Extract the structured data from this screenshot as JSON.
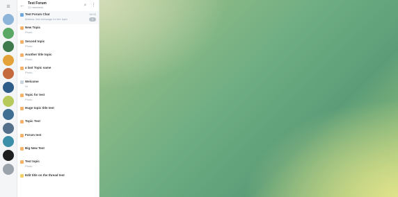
{
  "window": {
    "menu_icon": "menu-icon",
    "back_icon": "back-arrow-icon"
  },
  "forum": {
    "title": "Test Forum",
    "subtitle": "12 members",
    "search_icon": "search-icon",
    "more_icon": "more-icon"
  },
  "topics": [
    {
      "name": "Test Forum Chat",
      "preview": "Mateus: test message for the topic",
      "time": "16:03",
      "count": "1",
      "icon_color": "#6fa8dc",
      "pinned": true
    },
    {
      "name": "New Topic",
      "preview": "Photo",
      "time": "",
      "count": "",
      "icon_color": "#f6b26b"
    },
    {
      "name": "Second topic",
      "preview": "Photo",
      "time": "",
      "count": "",
      "icon_color": "#f6b26b"
    },
    {
      "name": "Another title topic",
      "preview": "Photo",
      "time": "",
      "count": "",
      "icon_color": "#f6b26b"
    },
    {
      "name": "a last Topic name",
      "preview": "Photo",
      "time": "",
      "count": "",
      "icon_color": "#f6b26b"
    },
    {
      "name": "Welcome",
      "preview": "Hi",
      "time": "",
      "count": "",
      "icon_color": "#c9d7e2"
    },
    {
      "name": "Topic for test",
      "preview": "Photo",
      "time": "",
      "count": "",
      "icon_color": "#f6b26b"
    },
    {
      "name": "Huge topic title test",
      "preview": "",
      "time": "",
      "count": "",
      "icon_color": "#f6b26b"
    },
    {
      "name": "Topic Test",
      "preview": "",
      "time": "",
      "count": "",
      "icon_color": "#f6b26b"
    },
    {
      "name": "Forum test",
      "preview": "",
      "time": "",
      "count": "",
      "icon_color": "#f6b26b"
    },
    {
      "name": "Big New Test",
      "preview": "",
      "time": "",
      "count": "",
      "icon_color": "#f6b26b"
    },
    {
      "name": "Test topic",
      "preview": "Photo",
      "time": "",
      "count": "",
      "icon_color": "#f6b26b"
    },
    {
      "name": "Edit title on the thread test",
      "preview": "",
      "time": "",
      "count": "",
      "icon_color": "#f2d16b"
    }
  ],
  "rail": [
    {
      "name": "avatar-forum",
      "color": "#8db4d9"
    },
    {
      "name": "avatar-chat-1",
      "color": "#5aa865"
    },
    {
      "name": "avatar-chat-2",
      "color": "#3e7a4e"
    },
    {
      "name": "avatar-chat-3",
      "color": "#e3a33a"
    },
    {
      "name": "avatar-chat-4",
      "color": "#c56a3d"
    },
    {
      "name": "avatar-chat-5",
      "color": "#2f5d8a"
    },
    {
      "name": "avatar-chat-6",
      "color": "#b7c95a"
    },
    {
      "name": "avatar-chat-7",
      "color": "#3f6e93"
    },
    {
      "name": "avatar-chat-8",
      "color": "#55708a"
    },
    {
      "name": "avatar-chat-9",
      "color": "#3c8fa8"
    },
    {
      "name": "avatar-chat-10",
      "color": "#1f1f1f"
    },
    {
      "name": "avatar-chat-11",
      "color": "#9aa3ab"
    }
  ]
}
